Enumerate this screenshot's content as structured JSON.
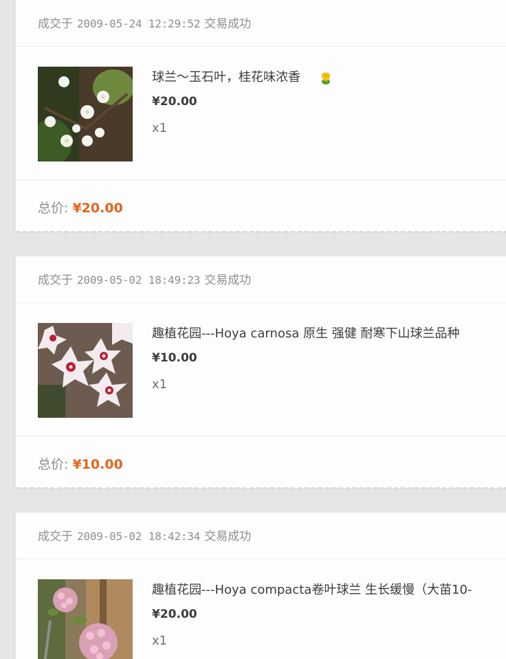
{
  "orders": [
    {
      "header_prefix": "成交于",
      "date": "2009-05-24 12:29:52",
      "status": "交易成功",
      "item_title": "球兰～玉石叶，桂花味浓香",
      "item_price": "¥20.00",
      "item_qty": "x1",
      "total_label": "总价:",
      "total_value": "¥20.00",
      "thumb_icon": "white-hoya-flower-photo"
    },
    {
      "header_prefix": "成交于",
      "date": "2009-05-02 18:49:23",
      "status": "交易成功",
      "item_title": "趣植花园---Hoya carnosa 原生 强健 耐寒下山球兰品种",
      "item_price": "¥10.00",
      "item_qty": "x1",
      "total_label": "总价:",
      "total_value": "¥10.00",
      "thumb_icon": "pink-hoya-carnosa-photo"
    },
    {
      "header_prefix": "成交于",
      "date": "2009-05-02 18:42:34",
      "status": "交易成功",
      "item_title": "趣植花园---Hoya compacta卷叶球兰 生长缓慢（大苗10-",
      "item_price": "¥20.00",
      "item_qty": "x1",
      "thumb_icon": "pink-hoya-compacta-photo"
    }
  ],
  "colors": {
    "accent_price": "#e4641c",
    "background": "#e6e5e8",
    "card": "#fdfdfe"
  }
}
